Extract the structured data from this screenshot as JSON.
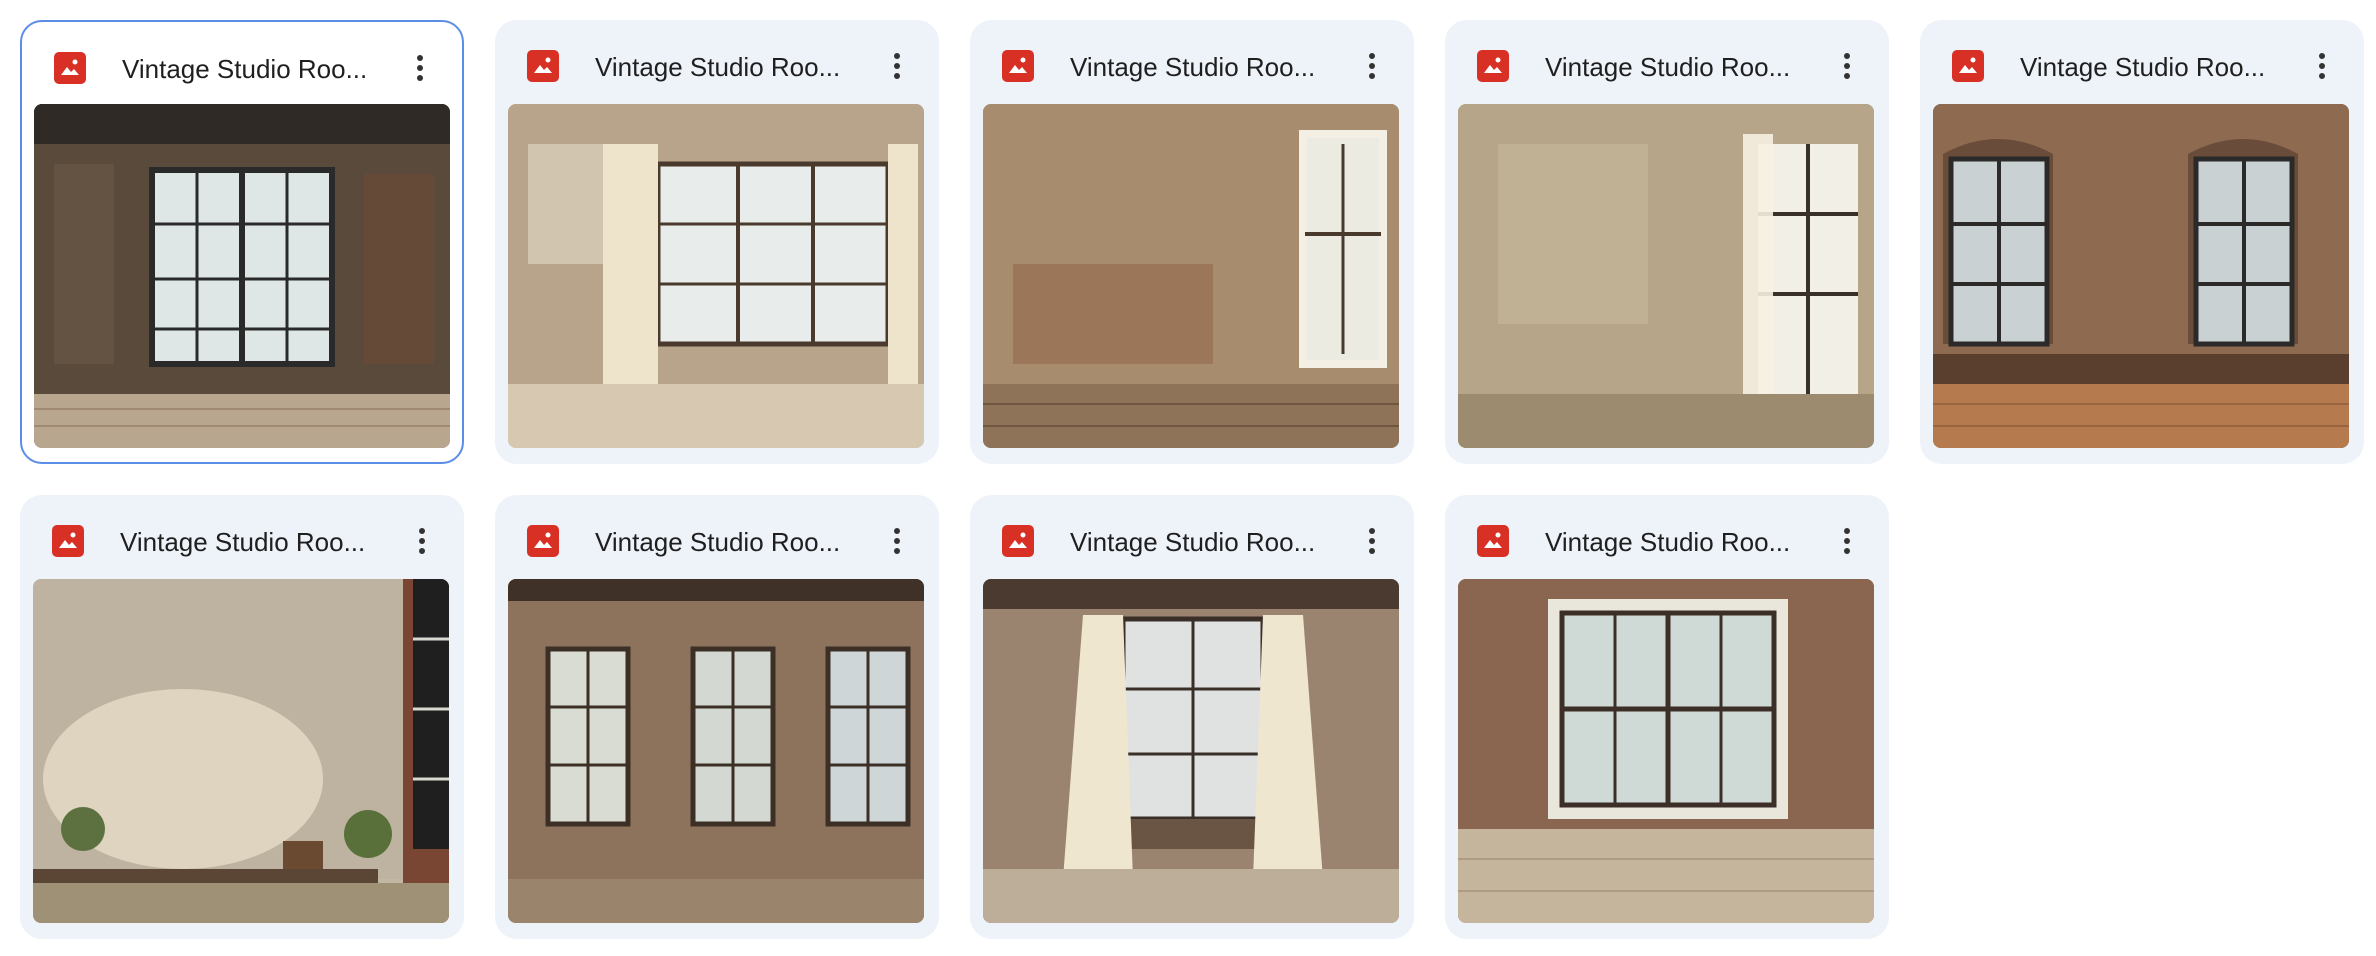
{
  "files": [
    {
      "title": "Vintage Studio Roo...",
      "selected": true,
      "variant": "twin-window"
    },
    {
      "title": "Vintage Studio Roo...",
      "selected": false,
      "variant": "curtain-wide"
    },
    {
      "title": "Vintage Studio Roo...",
      "selected": false,
      "variant": "right-window"
    },
    {
      "title": "Vintage Studio Roo...",
      "selected": false,
      "variant": "sheer-window"
    },
    {
      "title": "Vintage Studio Roo...",
      "selected": false,
      "variant": "arched-pair"
    },
    {
      "title": "Vintage Studio Roo...",
      "selected": false,
      "variant": "plaster-bench"
    },
    {
      "title": "Vintage Studio Roo...",
      "selected": false,
      "variant": "triple-window"
    },
    {
      "title": "Vintage Studio Roo...",
      "selected": false,
      "variant": "curtain-center"
    },
    {
      "title": "Vintage Studio Roo...",
      "selected": false,
      "variant": "framed-window"
    }
  ],
  "icons": {
    "file_type": "image-file-icon",
    "menu": "more-vert-icon"
  },
  "colors": {
    "image_icon": "#d93025",
    "card_bg": "#eef2f9",
    "selected_border": "#5b8ee6",
    "title_text": "#1f1f1f"
  }
}
